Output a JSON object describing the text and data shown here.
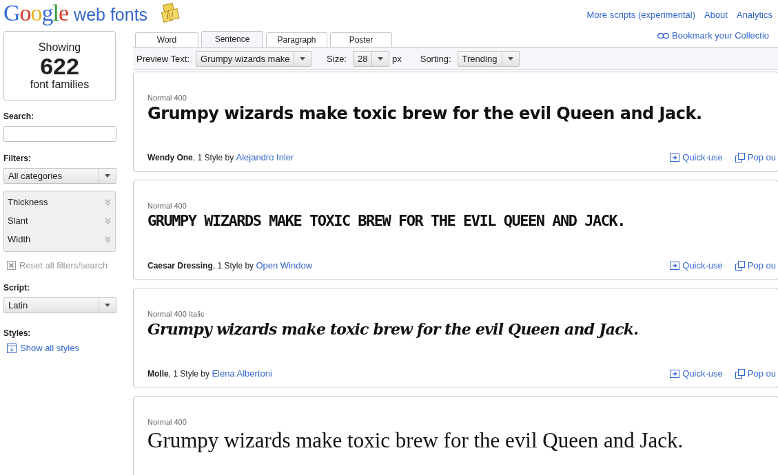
{
  "header": {
    "logo_brand": "Google",
    "logo_product": "web fonts",
    "links": [
      "More scripts (experimental)",
      "About",
      "Analytics"
    ]
  },
  "sidebar": {
    "count_label": "Showing",
    "count": "622",
    "count_unit": "font families",
    "search_label": "Search:",
    "filters_label": "Filters:",
    "category": "All categories",
    "filters": [
      {
        "label": "Thickness",
        "expanded": false
      },
      {
        "label": "Slant",
        "expanded": false
      },
      {
        "label": "Width",
        "expanded": false
      }
    ],
    "reset": {
      "label": "Reset all filters/search",
      "disabled": true
    },
    "script_label": "Script:",
    "script": "Latin",
    "styles_label": "Styles:",
    "show_styles": "Show all styles"
  },
  "tabs": [
    {
      "label": "Word",
      "selected": false
    },
    {
      "label": "Sentence",
      "selected": true
    },
    {
      "label": "Paragraph",
      "selected": false
    },
    {
      "label": "Poster",
      "selected": false
    }
  ],
  "bookmark": "Bookmark your Collectio",
  "toolbar": {
    "preview_label": "Preview Text:",
    "preview_value": "Grumpy wizards make",
    "size_label": "Size:",
    "size_value": "28",
    "size_unit": "px",
    "sorting_label": "Sorting:",
    "sorting_value": "Trending"
  },
  "fonts": [
    {
      "style": "Normal 400",
      "kind": "heavy",
      "preview": "Grumpy wizards make toxic brew for the evil Queen and Jack.",
      "name": "Wendy One",
      "styles": ", 1 Style by ",
      "author": "Alejandro Inler",
      "quick_use": "Quick-use",
      "pop_out": "Pop ou"
    },
    {
      "style": "Normal 400",
      "kind": "caps",
      "preview": "GRUMPY WIZARDS MAKE TOXIC BREW FOR THE EVIL QUEEN AND JACK.",
      "name": "Caesar Dressing",
      "styles": ", 1 Style by ",
      "author": "Open Window",
      "quick_use": "Quick-use",
      "pop_out": "Pop ou"
    },
    {
      "style": "Normal 400 Italic",
      "kind": "script",
      "preview": "Grumpy wizards make toxic brew for the evil Queen and Jack.",
      "name": "Molle",
      "styles": ", 1 Style by ",
      "author": "Elena Albertoni",
      "quick_use": "Quick-use",
      "pop_out": "Pop ou"
    },
    {
      "style": "Normal 400",
      "kind": "serif",
      "preview": "Grumpy wizards make toxic brew for the evil Queen and Jack."
    }
  ]
}
